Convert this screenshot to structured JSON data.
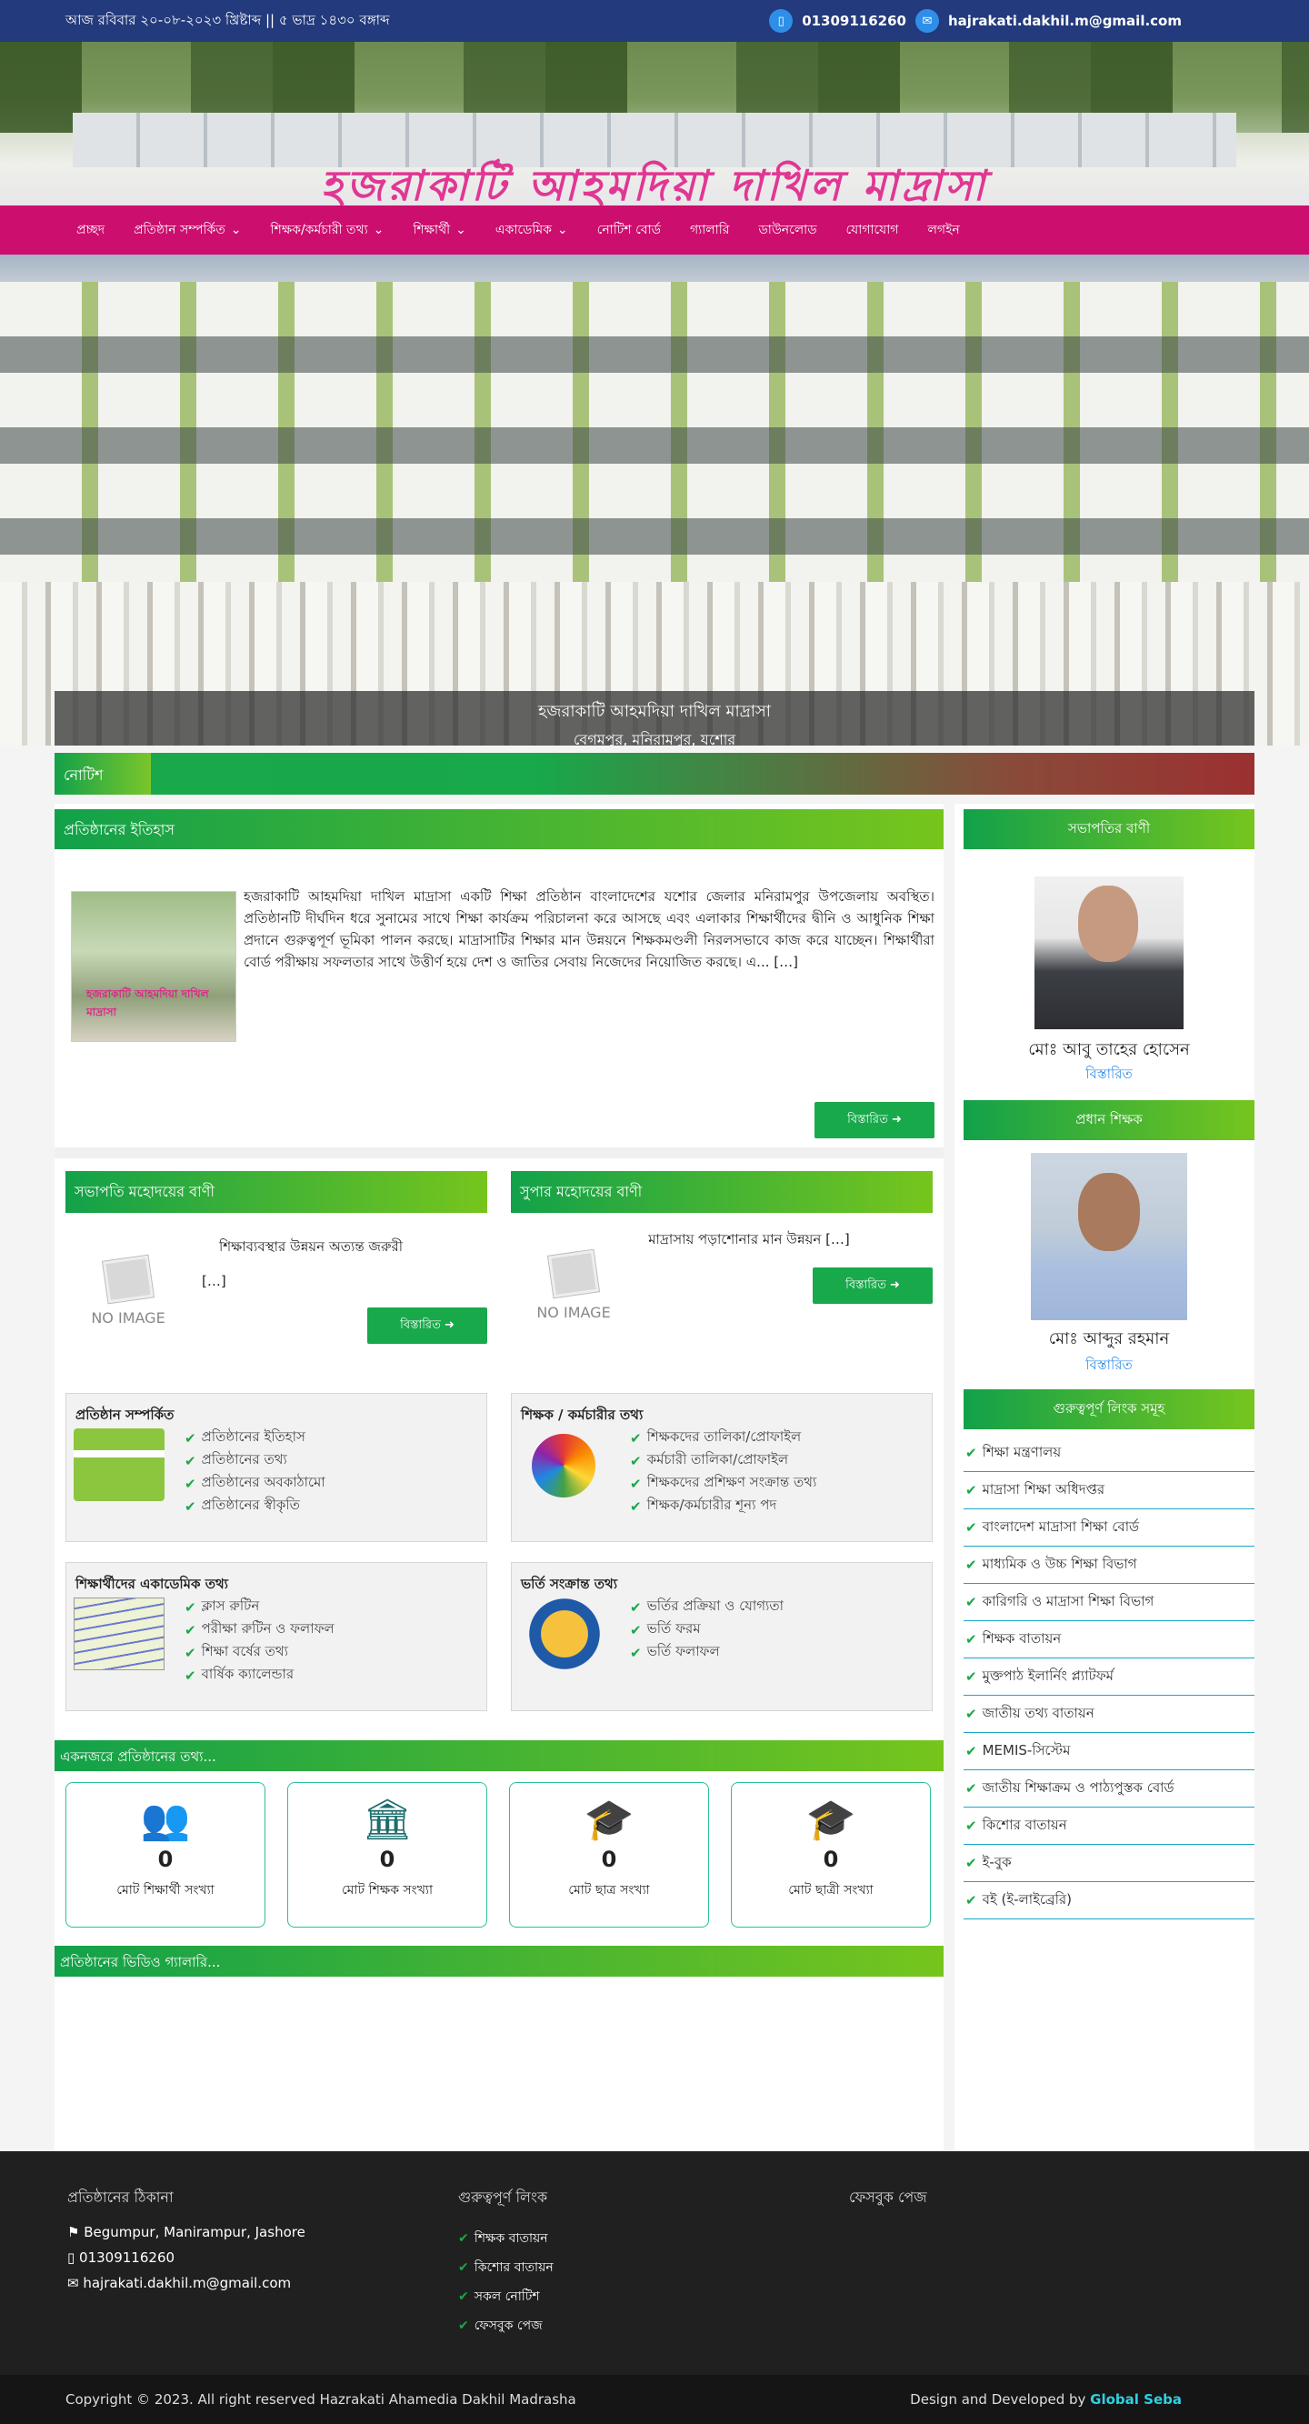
{
  "topbar": {
    "title": "আজ রবিবার ২০-০৮-২০২৩ খ্রিষ্টাব্দ || ৫ ভাদ্র ১৪৩০ বঙ্গাব্দ",
    "phone": "01309116260",
    "email": "hajrakati.dakhil.m@gmail.com",
    "phone_icon": "mobile-icon",
    "email_icon": "envelope-icon"
  },
  "banner": {
    "logo_text": "হজরাকাটি আহমদিয়া দাখিল মাদ্রাসা"
  },
  "nav": {
    "items": [
      "প্রচ্ছদ",
      "প্রতিষ্ঠান সম্পর্কিত",
      "শিক্ষক/কর্মচারী তথ্য",
      "শিক্ষার্থী",
      "একাডেমিক",
      "নোটিশ বোর্ড",
      "গ্যালারি",
      "ডাউনলোড",
      "যোগাযোগ",
      "লগইন"
    ],
    "dropdowns": [
      false,
      true,
      true,
      true,
      true,
      false,
      false,
      false,
      false,
      false
    ]
  },
  "hero": {
    "caption_title": "হজরাকাটি আহমদিয়া দাখিল মাদ্রাসা",
    "caption_sub": "বেগমপুর, মনিরামপুর, যশোর"
  },
  "notice": {
    "label": "নোটিশ"
  },
  "about": {
    "heading": "প্রতিষ্ঠানের ইতিহাস",
    "text": "হজরাকাটি আহমদিয়া দাখিল মাদ্রাসা একটি শিক্ষা প্রতিষ্ঠান বাংলাদেশের যশোর জেলার মনিরামপুর উপজেলায় অবস্থিত। প্রতিষ্ঠানটি দীর্ঘদিন ধরে সুনামের সাথে শিক্ষা কার্যক্রম পরিচালনা করে আসছে এবং এলাকার শিক্ষার্থীদের দ্বীনি ও আধুনিক শিক্ষা প্রদানে গুরুত্বপূর্ণ ভূমিকা পালন করছে। মাদ্রাসাটির শিক্ষার মান উন্নয়নে শিক্ষকমণ্ডলী নিরলসভাবে কাজ করে যাচ্ছেন। শিক্ষার্থীরা বোর্ড পরীক্ষায় সফলতার সাথে উত্তীর্ণ হয়ে দেশ ও জাতির সেবায় নিজেদের নিয়োজিত করছে। এ... […]",
    "button": "বিস্তারিত"
  },
  "messages": [
    {
      "heading": "সভাপতি মহোদয়ের বাণী",
      "title": "শিক্ষাব্যবস্থার উন্নয়ন অত্যন্ত জরুরী",
      "body": "[…]",
      "image_label": "NO IMAGE",
      "button": "বিস্তারিত"
    },
    {
      "heading": "সুপার মহোদয়ের বাণী",
      "title": "মাদ্রাসায় পড়াশোনার মান উন্নয়ন […]",
      "body": "",
      "image_label": "NO IMAGE",
      "button": "বিস্তারিত"
    }
  ],
  "cards": [
    {
      "heading": "প্রতিষ্ঠান সম্পর্কিত",
      "items": [
        "প্রতিষ্ঠানের ইতিহাস",
        "প্রতিষ্ঠানের তথ্য",
        "প্রতিষ্ঠানের অবকাঠামো",
        "প্রতিষ্ঠানের স্বীকৃতি"
      ],
      "icon": "institution-icon"
    },
    {
      "heading": "শিক্ষক / কর্মচারীর তথ্য",
      "items": [
        "শিক্ষকদের তালিকা/প্রোফাইল",
        "কর্মচারী তালিকা/প্রোফাইল",
        "শিক্ষকদের প্রশিক্ষণ সংক্রান্ত তথ্য",
        "শিক্ষক/কর্মচারীর শূন্য পদ"
      ],
      "icon": "people-wheel-icon"
    },
    {
      "heading": "শিক্ষার্থীদের একাডেমিক তথ্য",
      "items": [
        "ক্লাস রুটিন",
        "পরীক্ষা রুটিন ও ফলাফল",
        "শিক্ষা বর্ষের তথ্য",
        "বার্ষিক ক্যালেন্ডার"
      ],
      "icon": "documents-icon"
    },
    {
      "heading": "ভর্তি সংক্রান্ত তথ্য",
      "items": [
        "ভর্তির প্রক্রিয়া ও যোগ্যতা",
        "ভর্তি ফরম",
        "ভর্তি ফলাফল"
      ],
      "icon": "graduation-icon"
    }
  ],
  "stats": {
    "heading": "একনজরে প্রতিষ্ঠানের তথ্য...",
    "items": [
      {
        "value": "0",
        "label": "মোট শিক্ষার্থী সংখ্যা",
        "icon": "users-icon"
      },
      {
        "value": "0",
        "label": "মোট শিক্ষক সংখ্যা",
        "icon": "bank-icon"
      },
      {
        "value": "0",
        "label": "মোট ছাত্র সংখ্যা",
        "icon": "student-icon"
      },
      {
        "value": "0",
        "label": "মোট ছাত্রী সংখ্যা",
        "icon": "student-female-icon"
      }
    ]
  },
  "video": {
    "heading": "প্রতিষ্ঠানের ভিডিও গ্যালারি..."
  },
  "sidebar": {
    "president": {
      "heading": "সভাপতির বাণী",
      "name": "মোঃ আবু তাহের হোসেন",
      "role": "বিস্তারিত"
    },
    "principal": {
      "heading": "প্রধান শিক্ষক",
      "name": "মোঃ আব্দুর রহমান",
      "role": "বিস্তারিত"
    },
    "links_heading": "গুরুত্বপূর্ণ লিংক সমূহ",
    "links": [
      "শিক্ষা মন্ত্রণালয়",
      "মাদ্রাসা শিক্ষা অধিদপ্তর",
      "বাংলাদেশ মাদ্রাসা শিক্ষা বোর্ড",
      "মাধ্যমিক ও উচ্চ শিক্ষা বিভাগ",
      "কারিগরি ও মাদ্রাসা শিক্ষা বিভাগ",
      "শিক্ষক বাতায়ন",
      "মুক্তপাঠ ইলার্নিং প্ল্যাটফর্ম",
      "জাতীয় তথ্য বাতায়ন",
      "MEMIS-সিস্টেম",
      "জাতীয় শিক্ষাক্রম ও পাঠ্যপুস্তক বোর্ড",
      "কিশোর বাতায়ন",
      "ই-বুক",
      "বই (ই-লাইব্রেরি)"
    ]
  },
  "footer": {
    "col1_heading": "প্রতিষ্ঠানের ঠিকানা",
    "address": "Begumpur, Manirampur, Jashore",
    "phone": "01309116260",
    "email": "hajrakati.dakhil.m@gmail.com",
    "col2_heading": "গুরুত্বপূর্ণ লিংক",
    "col2_links": [
      "শিক্ষক বাতায়ন",
      "কিশোর বাতায়ন",
      "সকল নোটিশ",
      "ফেসবুক পেজ"
    ],
    "col3_heading": "ফেসবুক পেজ"
  },
  "copyright": {
    "text": "Copyright © 2023. All right reserved Hazrakati Ahamedia Dakhil Madrasha",
    "credit_prefix": "Design and Developed by",
    "credit_name": "Global Seba"
  },
  "colors": {
    "topbar": "#233a7c",
    "nav": "#cc0e6e",
    "green": "#17a94a",
    "footer": "#202020"
  }
}
